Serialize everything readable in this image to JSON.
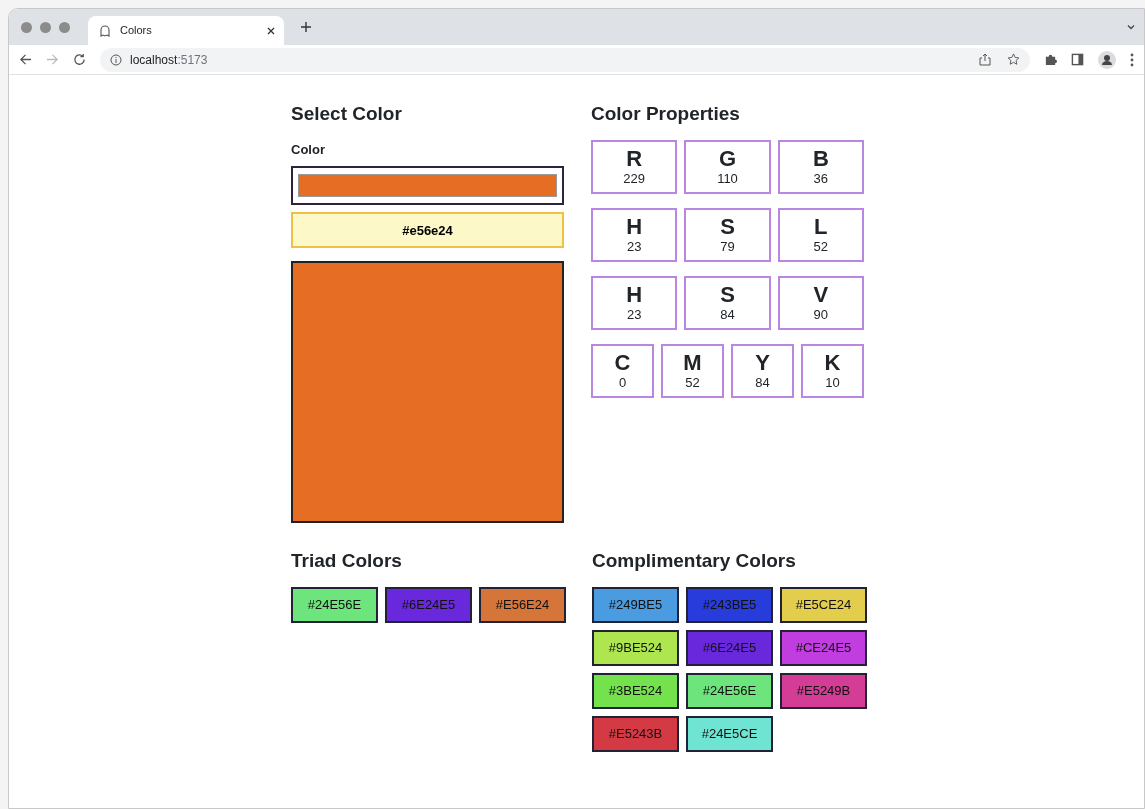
{
  "browser": {
    "tab_title": "Colors",
    "url_host": "localhost",
    "url_port": ":5173"
  },
  "select_color": {
    "title": "Select Color",
    "label": "Color",
    "color": "#e56e24",
    "hex_value": "#e56e24"
  },
  "color_properties": {
    "title": "Color Properties",
    "rows": [
      [
        {
          "label": "R",
          "value": "229"
        },
        {
          "label": "G",
          "value": "110"
        },
        {
          "label": "B",
          "value": "36"
        }
      ],
      [
        {
          "label": "H",
          "value": "23"
        },
        {
          "label": "S",
          "value": "79"
        },
        {
          "label": "L",
          "value": "52"
        }
      ],
      [
        {
          "label": "H",
          "value": "23"
        },
        {
          "label": "S",
          "value": "84"
        },
        {
          "label": "V",
          "value": "90"
        }
      ],
      [
        {
          "label": "C",
          "value": "0"
        },
        {
          "label": "M",
          "value": "52"
        },
        {
          "label": "Y",
          "value": "84"
        },
        {
          "label": "K",
          "value": "10"
        }
      ]
    ]
  },
  "triad": {
    "title": "Triad Colors",
    "swatches": [
      {
        "label": "#24E56E",
        "color": "#6ee47c"
      },
      {
        "label": "#6E24E5",
        "color": "#6a28dc"
      },
      {
        "label": "#E56E24",
        "color": "#d6753a"
      }
    ]
  },
  "complimentary": {
    "title": "Complimentary Colors",
    "swatches": [
      {
        "label": "#249BE5",
        "color": "#4a9be0"
      },
      {
        "label": "#243BE5",
        "color": "#283cdc"
      },
      {
        "label": "#E5CE24",
        "color": "#e3cd4c"
      },
      {
        "label": "#9BE524",
        "color": "#ade64f"
      },
      {
        "label": "#6E24E5",
        "color": "#6a28dc"
      },
      {
        "label": "#CE24E5",
        "color": "#c23ddf"
      },
      {
        "label": "#3BE524",
        "color": "#74e24c"
      },
      {
        "label": "#24E56E",
        "color": "#6ee47c"
      },
      {
        "label": "#E5249B",
        "color": "#d33d96"
      },
      {
        "label": "#E5243B",
        "color": "#d43a44"
      },
      {
        "label": "#24E5CE",
        "color": "#70e4d2"
      }
    ]
  }
}
